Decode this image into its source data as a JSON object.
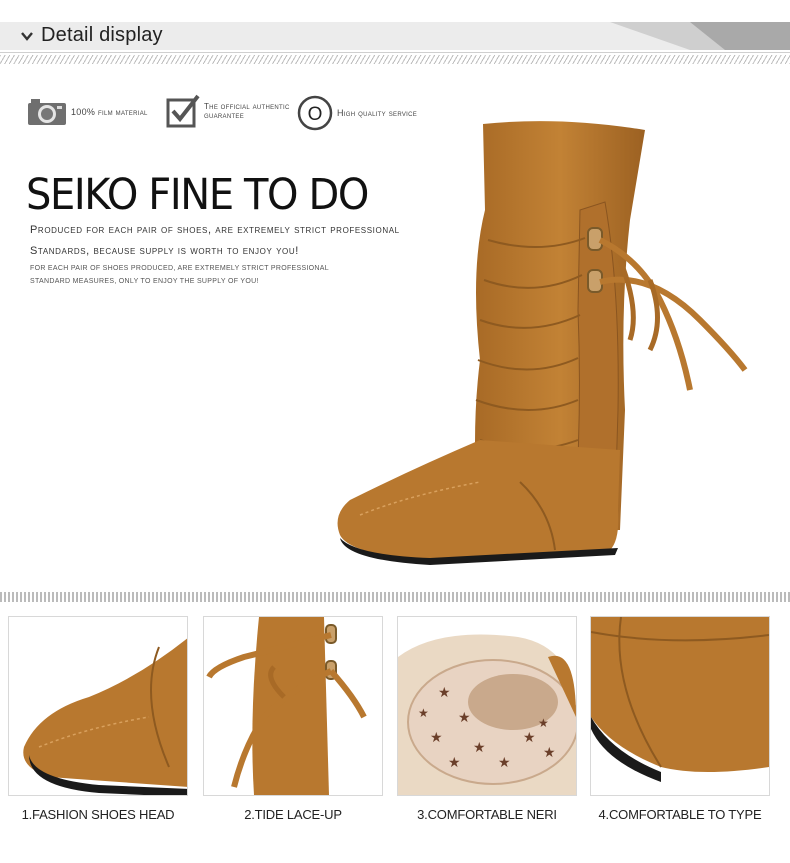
{
  "header": {
    "title": "Detail display",
    "icon": "chevron-down-icon",
    "bar_color": "#ececec"
  },
  "badges": [
    {
      "icon": "camera-icon",
      "text": "100% film material"
    },
    {
      "icon": "checkbox-icon",
      "text": "The official authentic guarantee"
    },
    {
      "icon": "circle-o-icon",
      "text": "High quality service",
      "glyph": "O"
    }
  ],
  "headline": "SEIKO FINE TO DO",
  "subtitle_line1": "Produced for each pair of shoes, are extremely strict professional",
  "subtitle_line2": "Standards, because supply is worth to enjoy you!",
  "small_line1": "for each pair of shoes produced, are extremely strict professional",
  "small_line2": "standard measures, only to enjoy the supply of you!",
  "colors": {
    "suede": "#b8782f",
    "suede_dark": "#8e5a20",
    "sole": "#1a1a1a",
    "lining": "#e8d3c2",
    "star": "#6b3f2a"
  },
  "details": [
    {
      "caption": "1.FASHION SHOES HEAD"
    },
    {
      "caption": "2.TIDE LACE-UP"
    },
    {
      "caption": "3.COMFORTABLE NERI"
    },
    {
      "caption": "4.COMFORTABLE TO TYPE"
    }
  ]
}
